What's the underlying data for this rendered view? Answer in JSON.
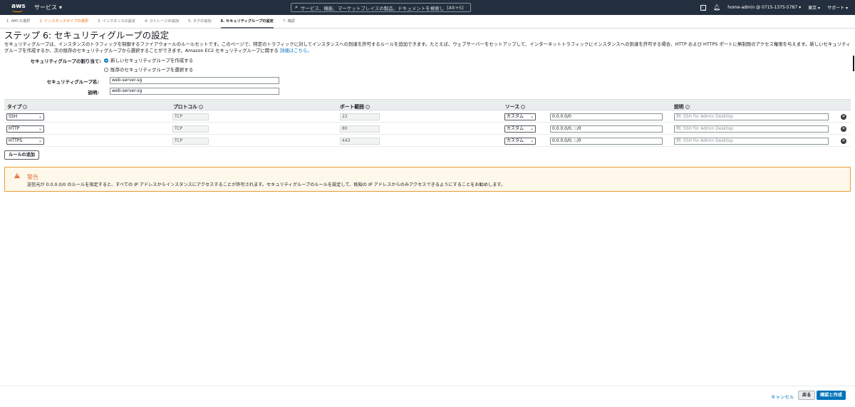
{
  "topnav": {
    "logo": "aws",
    "services": "サービス",
    "search_placeholder": "サービス、機能、マーケットプレイスの製品、ドキュメントを検索し",
    "search_shortcut": "[Alt+S]",
    "account": "home-admin @ 0715-1375-5787",
    "region": "東京",
    "support": "サポート"
  },
  "steps": [
    {
      "label": "1. AMI の選択"
    },
    {
      "label": "2. インスタンスタイプの選択"
    },
    {
      "label": "3. インスタンスの設定"
    },
    {
      "label": "4. ストレージの追加"
    },
    {
      "label": "5. タグの追加"
    },
    {
      "label": "6. セキュリティグループの設定"
    },
    {
      "label": "7. 確認"
    }
  ],
  "page": {
    "title": "ステップ 6: セキュリティグループの設定",
    "description": "セキュリティグループは、インスタンスのトラフィックを制御するファイアウォールのルールセットです。このページで、特定のトラフィックに対してインスタンスへの到達を許可するルールを追加できます。たとえば、ウェブサーバーをセットアップして、インターネットトラフィックにインスタンスへの到達を許可する場合、HTTP および HTTPS ポートに無制限のアクセス権限を与えます。新しいセキュリティグループを作成するか、次の既存のセキュリティグループから選択することができます。Amazon EC2 セキュリティグループに関する",
    "details_link": "詳細はこちら。"
  },
  "form": {
    "assign_label": "セキュリティグループの割り当て:",
    "radio_new": "新しいセキュリティグループを作成する",
    "radio_existing": "既存のセキュリティグループを選択する",
    "name_label": "セキュリティグループ名:",
    "name_value": "web-server-sg",
    "desc_label": "説明:",
    "desc_value": "web-server-sg"
  },
  "table": {
    "headers": {
      "type": "タイプ",
      "protocol": "プロトコル",
      "port": "ポート範囲",
      "source": "ソース",
      "description": "説明"
    },
    "rows": [
      {
        "type": "SSH",
        "protocol": "TCP",
        "port": "22",
        "source_mode": "カスタム",
        "source": "0.0.0.0/0",
        "desc_placeholder": "例: SSH for Admin Desktop"
      },
      {
        "type": "HTTP",
        "protocol": "TCP",
        "port": "80",
        "source_mode": "カスタム",
        "source": "0.0.0.0/0, ::/0",
        "desc_placeholder": "例: SSH for Admin Desktop"
      },
      {
        "type": "HTTPS",
        "protocol": "TCP",
        "port": "443",
        "source_mode": "カスタム",
        "source": "0.0.0.0/0, ::/0",
        "desc_placeholder": "例: SSH for Admin Desktop"
      }
    ]
  },
  "add_rule": "ルールの追加",
  "warning": {
    "title": "警告",
    "body": "送信元が 0.0.0.0/0 のルールを指定すると、すべての IP アドレスからインスタンスにアクセスすることが許可されます。セキュリティグループのルールを設定して、既知の IP アドレスからのみアクセスできるようにすることをお勧めします。"
  },
  "footer": {
    "cancel": "キャンセル",
    "back": "戻る",
    "confirm": "確認と作成"
  },
  "colors": {
    "nav_bg": "#232f3e",
    "accent": "#0073bb",
    "orange": "#ec7211",
    "warning_border": "#ec9c36"
  }
}
